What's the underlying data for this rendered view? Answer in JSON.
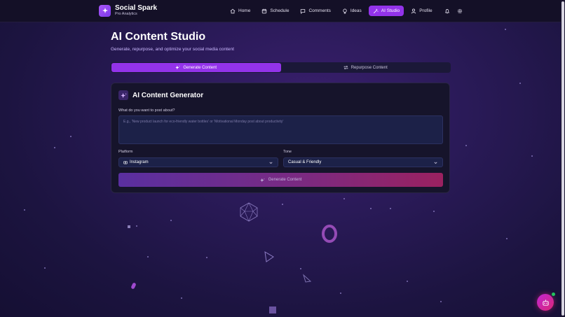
{
  "brand": {
    "name": "Social Spark",
    "subtitle": "Pro Analytics"
  },
  "nav": {
    "items": [
      {
        "label": "Home",
        "icon": "home-icon"
      },
      {
        "label": "Schedule",
        "icon": "calendar-icon"
      },
      {
        "label": "Comments",
        "icon": "message-icon"
      },
      {
        "label": "Ideas",
        "icon": "lightbulb-icon"
      },
      {
        "label": "AI Studio",
        "icon": "magic-wand-icon",
        "active": true
      },
      {
        "label": "Profile",
        "icon": "user-icon"
      }
    ],
    "notification_icon": "bell-icon",
    "settings_icon": "gear-icon"
  },
  "page": {
    "title": "AI Content Studio",
    "subtitle": "Generate, repurpose, and optimize your social media content"
  },
  "tabs": [
    {
      "label": "Generate Content",
      "icon": "sparkles-icon",
      "active": true
    },
    {
      "label": "Repurpose Content",
      "icon": "repeat-icon",
      "active": false
    }
  ],
  "generator": {
    "title": "AI Content Generator",
    "prompt_label": "What do you want to post about?",
    "prompt_placeholder": "E.g., 'New product launch for eco-friendly water bottles' or 'Motivational Monday post about productivity'",
    "platform_label": "Platform",
    "platform_value": "Instagram",
    "platform_icon": "camera-icon",
    "tone_label": "Tone",
    "tone_value": "Casual & Friendly",
    "generate_label": "Generate Content"
  },
  "colors": {
    "accent": "#9333ea",
    "background": "#1c1440",
    "fab_gradient_start": "#c026d3",
    "fab_gradient_end": "#db2777",
    "online_dot": "#22c55e"
  },
  "assistant": {
    "icon": "robot-icon"
  }
}
